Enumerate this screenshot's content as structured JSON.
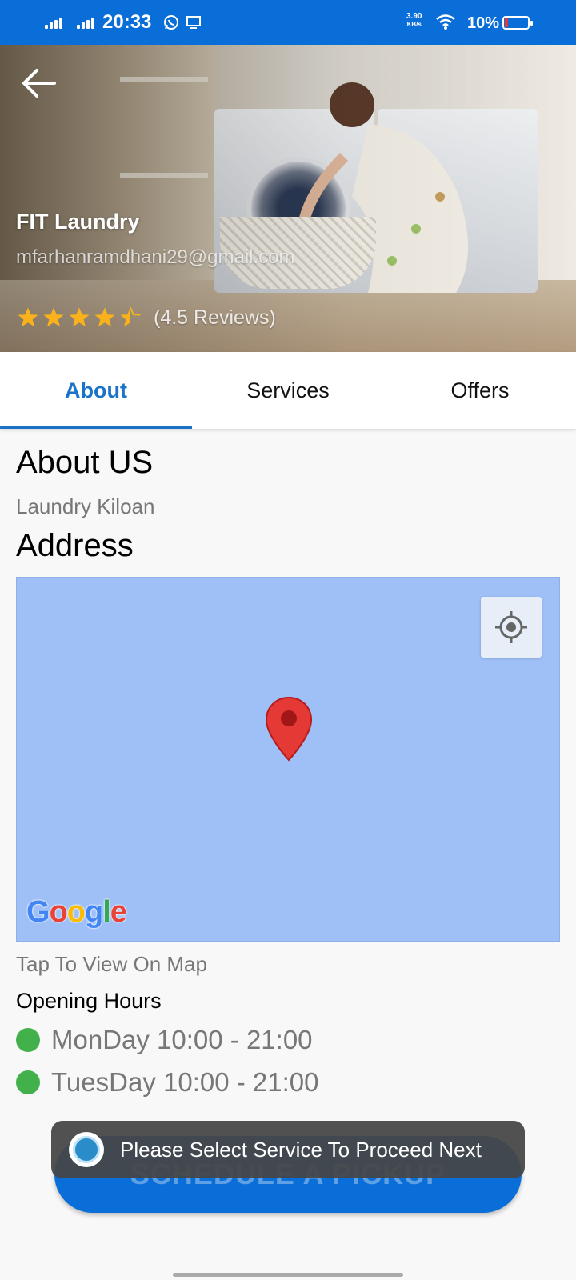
{
  "status_bar": {
    "time": "20:33",
    "net_speed_value": "3.90",
    "net_speed_unit": "KB/s",
    "battery_percent": "10%",
    "icons": [
      "signal-icon",
      "signal-icon",
      "whatsapp-icon",
      "screen-icon",
      "wifi-icon",
      "battery-icon"
    ]
  },
  "header": {
    "store_name": "FIT Laundry",
    "email": "mfarhanramdhani29@gmail.com",
    "rating": 4.5,
    "rating_label": "(4.5 Reviews)"
  },
  "tabs": [
    {
      "label": "About",
      "active": true
    },
    {
      "label": "Services",
      "active": false
    },
    {
      "label": "Offers",
      "active": false
    }
  ],
  "about": {
    "heading": "About US",
    "description": "Laundry Kiloan",
    "address_heading": "Address",
    "map_brand": "Google",
    "tap_to_view": "Tap To View On Map",
    "hours_heading": "Opening Hours",
    "hours": [
      {
        "text": "MonDay 10:00 - 21:00"
      },
      {
        "text": "TuesDay 10:00 - 21:00"
      }
    ]
  },
  "cta": {
    "label": "SCHEDULE A PICKUP"
  },
  "toast": {
    "message": "Please Select Service To Proceed Next"
  },
  "colors": {
    "primary": "#0a6ed8",
    "tab_active": "#1a73c8",
    "open_dot": "#43b14b",
    "star": "#f9b21b",
    "map_bg": "#9fc0f7"
  }
}
